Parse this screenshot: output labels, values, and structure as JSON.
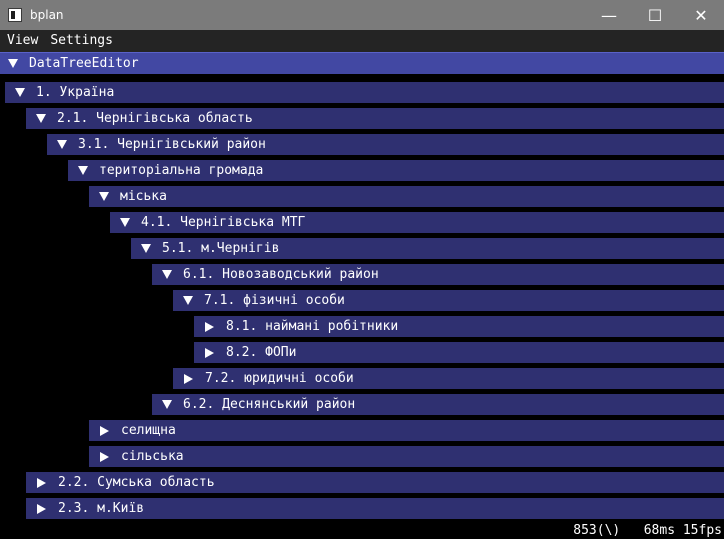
{
  "window": {
    "title": "bplan",
    "minimize_glyph": "—",
    "maximize_glyph": "☐",
    "close_glyph": "✕"
  },
  "menu": {
    "items": [
      "View",
      "Settings"
    ]
  },
  "editor": {
    "title": "DataTreeEditor"
  },
  "tree": [
    {
      "label": "1. Україна",
      "expanded": true,
      "depth": 0
    },
    {
      "label": "2.1. Чернігівська область",
      "expanded": true,
      "depth": 1
    },
    {
      "label": "3.1. Чернігівський район",
      "expanded": true,
      "depth": 2
    },
    {
      "label": "територіальна громада",
      "expanded": true,
      "depth": 3
    },
    {
      "label": "міська",
      "expanded": true,
      "depth": 4
    },
    {
      "label": "4.1. Чернігівська МТГ",
      "expanded": true,
      "depth": 5
    },
    {
      "label": "5.1. м.Чернігів",
      "expanded": true,
      "depth": 6
    },
    {
      "label": "6.1. Новозаводський район",
      "expanded": true,
      "depth": 7
    },
    {
      "label": "7.1. фізичні особи",
      "expanded": true,
      "depth": 8
    },
    {
      "label": "8.1. наймані робітники",
      "expanded": false,
      "depth": 9
    },
    {
      "label": "8.2. ФОПи",
      "expanded": false,
      "depth": 9
    },
    {
      "label": "7.2. юридичні особи",
      "expanded": false,
      "depth": 8
    },
    {
      "label": "6.2. Деснянський район",
      "expanded": true,
      "depth": 7
    },
    {
      "label": "селищна",
      "expanded": false,
      "depth": 4
    },
    {
      "label": "сільська",
      "expanded": false,
      "depth": 4
    },
    {
      "label": "2.2. Сумська область",
      "expanded": false,
      "depth": 1
    },
    {
      "label": "2.3. м.Київ",
      "expanded": false,
      "depth": 1
    }
  ],
  "status": {
    "text": "853(\\)   68ms 15fps"
  },
  "colors": {
    "background": "#000000",
    "row": "#2f3071",
    "header": "#4248a3",
    "titlebar": "#7b7b7b",
    "menubar": "#242424"
  }
}
